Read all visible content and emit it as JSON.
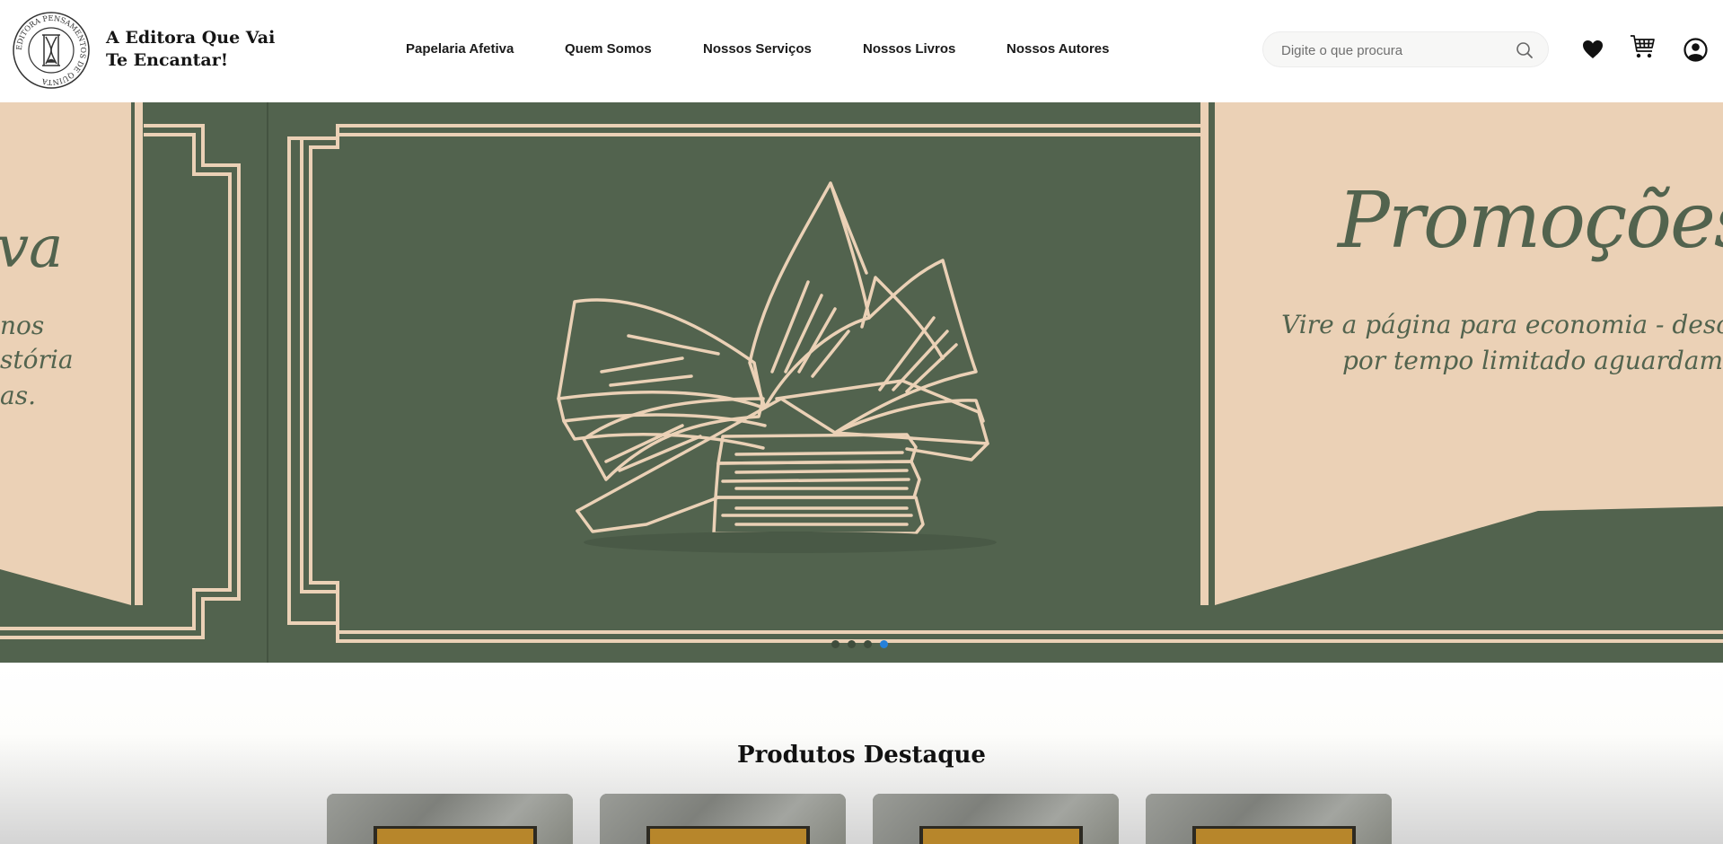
{
  "header": {
    "logo": {
      "ring_text": "EDITORA PENSAMENTOS DE QUINTA"
    },
    "tagline": {
      "line1": "A Editora Que Vai",
      "line2": "Te Encantar!"
    },
    "nav": [
      {
        "label": "Papelaria Afetiva"
      },
      {
        "label": "Quem Somos"
      },
      {
        "label": "Nossos Serviços"
      },
      {
        "label": "Nossos Livros"
      },
      {
        "label": "Nossos Autores"
      }
    ],
    "search": {
      "placeholder": "Digite o que procura",
      "icon": "search-icon"
    },
    "icons": [
      "heart-icon",
      "cart-icon",
      "user-icon"
    ]
  },
  "hero": {
    "current_slide": {
      "title": "Promoções",
      "subtitle_line1": "Vire a página para economia - desc",
      "subtitle_line2": "por tempo limitado aguardam"
    },
    "previous_slide_fragments": {
      "title": "va",
      "line1": "nos",
      "line2": "stória",
      "line3": "as."
    },
    "dots": {
      "count": 4,
      "active_index": 3
    },
    "colors": {
      "green": "#52634e",
      "cream": "#ebd1b6",
      "active_dot": "#2680d9"
    }
  },
  "featured": {
    "title": "Produtos Destaque",
    "products": [
      {
        "id": "p1"
      },
      {
        "id": "p2"
      },
      {
        "id": "p3"
      },
      {
        "id": "p4"
      }
    ]
  }
}
